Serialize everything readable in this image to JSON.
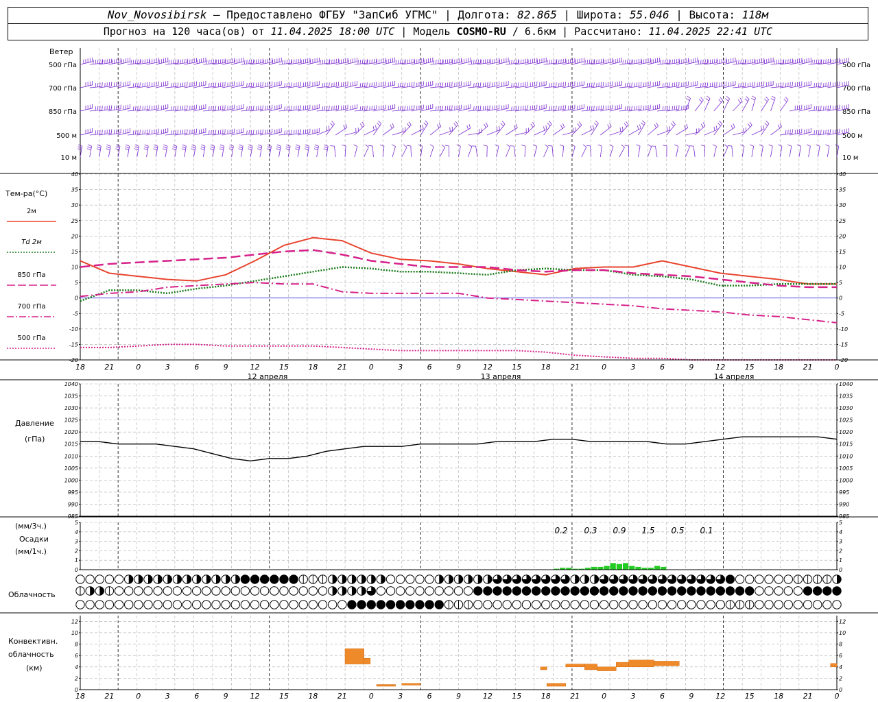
{
  "header": {
    "station": "Nov_Novosibirsk",
    "provided": " – Предоставлено ФГБУ \"ЗапСиб УГМС\" | Долгота: ",
    "lon": "82.865",
    "lat_label": " | Широта: ",
    "lat": "55.046",
    "alt_label": " | Высота: ",
    "alt": "118м",
    "forecast": "Прогноз на 120 часа(ов) от ",
    "run_time": "11.04.2025 18:00 UTC",
    "model_label": "  | Модель ",
    "model": "COSMO-RU",
    "resolution": " / 6.6км | Рассчитано: ",
    "calc_time": "11.04.2025 22:41 UTC"
  },
  "panels": {
    "wind_title": "Ветер",
    "wind_levels": [
      "500 гПа",
      "700 гПа",
      "850 гПа",
      "500 м",
      "10  м"
    ],
    "temp_title": "Тем-ра(°С)",
    "pressure_title": "Давление",
    "pressure_unit": "(гПа)",
    "precip_unit3": "(мм/3ч.)",
    "precip_title": "Осадки",
    "precip_unit1": "(мм/1ч.)",
    "cloud_title": "Облачность",
    "conv_title_1": "Конвективн.",
    "conv_title_2": "облачность",
    "conv_unit": "(км)"
  },
  "legend": [
    {
      "label": "2м",
      "color": "#e8442e",
      "dash": "solid"
    },
    {
      "label": "Td  2м",
      "color": "#1a7a1a",
      "dash": "dot"
    },
    {
      "label": "850 гПа",
      "color": "#d6208a",
      "dash": "longdash"
    },
    {
      "label": "700 гПа",
      "color": "#d6208a",
      "dash": "dashdot"
    },
    {
      "label": "500 гПа",
      "color": "#d6208a",
      "dash": "dot"
    }
  ],
  "time_axis": {
    "hour_labels": [
      "18",
      "21",
      "0",
      "3",
      "6",
      "9",
      "12",
      "15",
      "18",
      "21",
      "0",
      "3",
      "6",
      "9",
      "12",
      "15",
      "18",
      "21",
      "0",
      "3",
      "6",
      "9",
      "12",
      "15",
      "18",
      "21",
      "0"
    ],
    "date_labels": [
      "12 апреля",
      "13 апреля",
      "14 апреля"
    ]
  },
  "chart_data": [
    {
      "type": "line",
      "name": "temperature",
      "y_ticks": [
        40,
        35,
        30,
        25,
        20,
        15,
        10,
        5,
        0,
        -5,
        -10,
        -15,
        -20
      ],
      "ylim": [
        -20,
        40
      ],
      "x_hours": [
        0,
        3,
        6,
        9,
        12,
        15,
        18,
        21,
        24,
        27,
        30,
        33,
        36,
        39,
        42,
        45,
        48,
        51,
        54,
        57,
        60,
        63,
        66,
        69,
        72,
        75,
        78
      ],
      "series": [
        {
          "name": "2м",
          "color": "#e8442e",
          "values": [
            12,
            8,
            7,
            6,
            5.5,
            7.5,
            12,
            17,
            19.5,
            18.5,
            14.5,
            12.5,
            12,
            11,
            9.5,
            8.5,
            7.5,
            9.5,
            10,
            10,
            12,
            10,
            8,
            7,
            6,
            4.5,
            4.5
          ]
        },
        {
          "name": "Td 2м",
          "color": "#1a7a1a",
          "values": [
            -1,
            2.5,
            2.5,
            1.5,
            3,
            4,
            5.5,
            7,
            8.5,
            10,
            9.5,
            8.5,
            8.5,
            8,
            7.5,
            9,
            9.5,
            9,
            9,
            7.5,
            7,
            6,
            4,
            4,
            4.5,
            4.5,
            4.5
          ]
        },
        {
          "name": "850 гПа",
          "color": "#d6208a",
          "values": [
            10,
            11,
            11.5,
            12,
            12.5,
            13,
            14,
            15,
            15.5,
            14,
            12,
            11,
            10,
            10,
            10,
            9,
            8.5,
            9,
            9,
            8,
            7.5,
            7,
            6,
            5,
            4,
            3.5,
            3.5
          ]
        },
        {
          "name": "700 гПа",
          "color": "#d6208a",
          "values": [
            0.5,
            1.5,
            2,
            3.5,
            4,
            4.5,
            5,
            4.5,
            4.5,
            2,
            1.5,
            1.5,
            1.5,
            1.5,
            0,
            -0.5,
            -1,
            -1.5,
            -2,
            -2.5,
            -3.5,
            -4,
            -4.5,
            -5.5,
            -6,
            -7,
            -8
          ]
        },
        {
          "name": "500 гПа",
          "color": "#d6208a",
          "values": [
            -16,
            -16,
            -15.5,
            -15,
            -15,
            -15.5,
            -15.5,
            -15.5,
            -15.5,
            -16,
            -16.5,
            -17,
            -17,
            -17,
            -17,
            -17,
            -17.5,
            -18.5,
            -19,
            -19.5,
            -19.5,
            -20,
            -20,
            -20,
            -20,
            -20,
            -20
          ]
        }
      ]
    },
    {
      "type": "line",
      "name": "pressure",
      "y_ticks": [
        1040,
        1035,
        1030,
        1025,
        1020,
        1015,
        1010,
        1005,
        1000,
        995,
        990,
        985
      ],
      "ylim": [
        985,
        1040
      ],
      "x_hours": [
        0,
        3,
        6,
        9,
        12,
        15,
        18,
        21,
        24,
        27,
        30,
        33,
        36,
        39,
        42,
        45,
        48,
        51,
        54,
        57,
        60,
        63,
        66,
        69,
        72,
        75,
        78,
        81,
        84,
        87,
        90,
        93,
        96,
        99,
        102,
        105,
        108,
        111,
        114,
        117,
        120
      ],
      "values": [
        1016,
        1016,
        1015,
        1015,
        1015,
        1014,
        1013,
        1011,
        1009,
        1008,
        1009,
        1009,
        1010,
        1012,
        1013,
        1014,
        1014,
        1014,
        1015,
        1015,
        1015,
        1015,
        1016,
        1016,
        1016,
        1017,
        1017,
        1016,
        1016,
        1016,
        1016,
        1015,
        1015,
        1016,
        1017,
        1018,
        1018,
        1018,
        1018,
        1018,
        1017
      ]
    },
    {
      "type": "bar",
      "name": "precipitation",
      "ylim": [
        0,
        5
      ],
      "totals_3h_labels": [
        {
          "hour": 78,
          "value": "0.2"
        },
        {
          "hour": 81,
          "value": "0.3"
        },
        {
          "hour": 84,
          "value": "0.9"
        },
        {
          "hour": 87,
          "value": "1.5"
        },
        {
          "hour": 90,
          "value": "0.5"
        },
        {
          "hour": 93,
          "value": "0.1"
        }
      ],
      "hourly": [
        [
          76,
          0.1
        ],
        [
          77,
          0.2
        ],
        [
          78,
          0.2
        ],
        [
          79,
          0.1
        ],
        [
          80,
          0.1
        ],
        [
          81,
          0.2
        ],
        [
          82,
          0.3
        ],
        [
          83,
          0.3
        ],
        [
          84,
          0.4
        ],
        [
          85,
          0.7
        ],
        [
          86,
          0.6
        ],
        [
          87,
          0.7
        ],
        [
          88,
          0.4
        ],
        [
          89,
          0.3
        ],
        [
          90,
          0.2
        ],
        [
          91,
          0.2
        ],
        [
          92,
          0.4
        ],
        [
          93,
          0.3
        ]
      ]
    },
    {
      "type": "bar",
      "name": "convective_cloud",
      "y_ticks": [
        12,
        10,
        8,
        6,
        4,
        2,
        0
      ],
      "ylim": [
        0,
        13
      ],
      "segments": [
        {
          "h0": 42,
          "h1": 45,
          "bottom": 4.5,
          "top": 7.2
        },
        {
          "h0": 45,
          "h1": 46,
          "bottom": 4.5,
          "top": 5.5
        },
        {
          "h0": 47,
          "h1": 50,
          "bottom": 0.6,
          "top": 0.9
        },
        {
          "h0": 51,
          "h1": 54,
          "bottom": 0.8,
          "top": 1.1
        },
        {
          "h0": 73,
          "h1": 74,
          "bottom": 3.5,
          "top": 4.0
        },
        {
          "h0": 74,
          "h1": 77,
          "bottom": 0.6,
          "top": 1.1
        },
        {
          "h0": 77,
          "h1": 80,
          "bottom": 4.0,
          "top": 4.5
        },
        {
          "h0": 80,
          "h1": 82,
          "bottom": 3.5,
          "top": 4.5
        },
        {
          "h0": 82,
          "h1": 85,
          "bottom": 3.3,
          "top": 4.0
        },
        {
          "h0": 85,
          "h1": 87,
          "bottom": 4.0,
          "top": 4.8
        },
        {
          "h0": 87,
          "h1": 91,
          "bottom": 4.0,
          "top": 5.2
        },
        {
          "h0": 91,
          "h1": 95,
          "bottom": 4.2,
          "top": 5.0
        },
        {
          "h0": 119,
          "h1": 120,
          "bottom": 4.0,
          "top": 4.6
        }
      ]
    }
  ],
  "clouds": {
    "rows": [
      "0000022222222222244444411122222200000222222333333332223333333333333400000011112",
      "1221000000000000000000000022223000000000044444444444444444444444444444000004444",
      "0000000000000000000000000000444444444411100000000000000000000000000111000000000"
    ]
  }
}
